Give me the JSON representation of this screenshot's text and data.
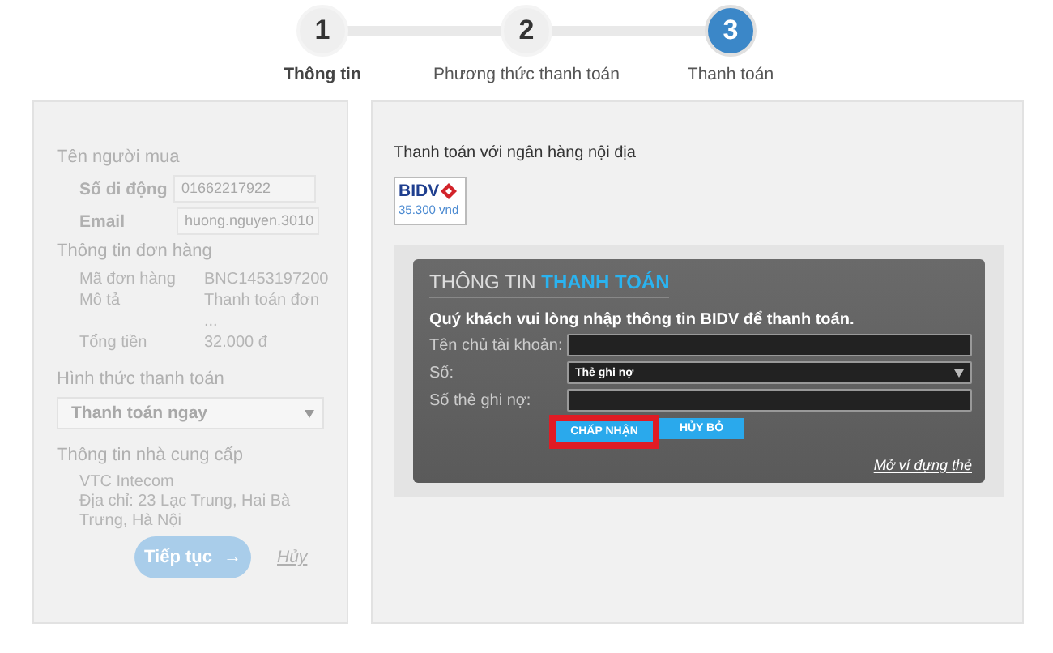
{
  "steps": [
    {
      "number": "1",
      "label": "Thông tin",
      "selected": false,
      "emphasized": true
    },
    {
      "number": "2",
      "label": "Phương thức thanh toán",
      "selected": false,
      "emphasized": false
    },
    {
      "number": "3",
      "label": "Thanh toán",
      "selected": true,
      "emphasized": false
    }
  ],
  "buyer": {
    "heading": "Tên người mua",
    "fields": [
      {
        "label": "Số di động",
        "value": "01662217922"
      },
      {
        "label": "Email",
        "value": "huong.nguyen.3010"
      }
    ]
  },
  "order": {
    "heading": "Thông tin đơn hàng",
    "rows": [
      {
        "label": "Mã đơn hàng",
        "value": "BNC1453197200"
      },
      {
        "label": "Mô tả",
        "value": "Thanh toán đơn ..."
      },
      {
        "label": "Tổng tiền",
        "value": "32.000 đ"
      }
    ]
  },
  "payment_method": {
    "heading": "Hình thức thanh toán",
    "select": {
      "value": "Thanh toán ngay"
    }
  },
  "provider": {
    "heading": "Thông tin nhà cung cấp",
    "lines": [
      "VTC Intecom",
      "Địa chỉ: 23 Lạc Trung, Hai Bà Trưng, Hà Nội"
    ]
  },
  "actions": {
    "continue": "Tiếp tục",
    "continue_arrow": "→",
    "cancel": "Hủy"
  },
  "payment": {
    "heading": "Thanh toán với ngân hàng nội địa",
    "bank": {
      "name": "BIDV",
      "price": "35.300 vnd"
    },
    "form": {
      "title": "THÔNG TIN",
      "title_highlight": "THANH TOÁN",
      "instruction": "Quý khách vui lòng nhập thông tin BIDV để thanh toán.",
      "fields": [
        {
          "label": "Tên chủ tài khoản:",
          "kind": "text"
        },
        {
          "label": "Số:",
          "kind": "select",
          "value": "Thẻ ghi nợ"
        },
        {
          "label": "Số thẻ ghi nợ:",
          "kind": "text"
        }
      ],
      "buttons": [
        {
          "label": "CHẤP NHẬN",
          "highlighted": true
        },
        {
          "label": "HỦY BỎ",
          "highlighted": false
        }
      ],
      "link": "Mở ví đựng thẻ"
    }
  }
}
